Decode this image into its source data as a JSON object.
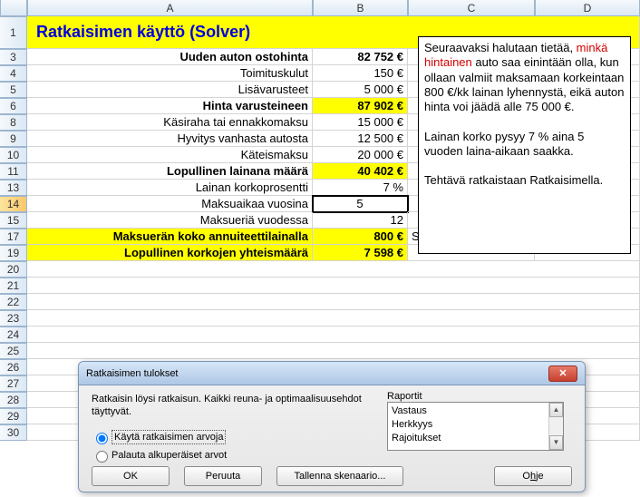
{
  "columns": [
    "A",
    "B",
    "C",
    "D"
  ],
  "row_headers": [
    "1",
    "3",
    "4",
    "5",
    "6",
    "8",
    "9",
    "10",
    "11",
    "13",
    "14",
    "15",
    "17",
    "19",
    "20",
    "21",
    "22",
    "23",
    "24",
    "25",
    "26",
    "27",
    "28",
    "29",
    "30"
  ],
  "selected_row_index": 10,
  "title": "Ratkaisimen käyttö (Solver)",
  "rows": {
    "r3": {
      "a": "Uuden auton ostohinta",
      "b": "82 752 €",
      "bold": true
    },
    "r4": {
      "a": "Toimituskulut",
      "b": "150 €"
    },
    "r5": {
      "a": "Lisävarusteet",
      "b": "5 000 €"
    },
    "r6": {
      "a": "Hinta varusteineen",
      "b": "87 902 €",
      "bold": true,
      "yellow": true
    },
    "r8": {
      "a": "Käsiraha tai ennakkomaksu",
      "b": "15 000 €"
    },
    "r9": {
      "a": "Hyvitys vanhasta autosta",
      "b": "12 500 €"
    },
    "r10": {
      "a": "Käteismaksu",
      "b": "20 000 €"
    },
    "r11": {
      "a": "Lopullinen lainana määrä",
      "b": "40 402 €",
      "bold": true,
      "yellow": true
    },
    "r13": {
      "a": "Lainan korkoprosentti",
      "b": "7 %"
    },
    "r14": {
      "a": "Maksuaikaa vuosina",
      "b": "5",
      "active": true
    },
    "r15": {
      "a": "Maksueriä vuodessa",
      "b": "12"
    },
    "r17": {
      "a": "Maksuerän koko annuiteettilainalla",
      "b": "800 €",
      "bold": true,
      "yellow": true,
      "c": "Solussa käytetty maksu funktiota"
    },
    "r19": {
      "a": "Lopullinen korkojen yhteismäärä",
      "b": "7 598 €",
      "bold": true,
      "yellow": true
    }
  },
  "note": {
    "p1a": "Seuraavaksi halutaan tietää, ",
    "p1red": "minkä hintainen",
    "p1b": " auto saa einintään olla, kun ollaan valmiit maksamaan korkeintaan 800 €/kk lainan lyhennystä, eikä auton hinta voi jäädä alle 75 000 €.",
    "p2": "Lainan korko pysyy 7 % aina 5 vuoden laina-aikaan saakka.",
    "p3": "Tehtävä ratkaistaan Ratkaisimella."
  },
  "dialog": {
    "title": "Ratkaisimen tulokset",
    "msg": "Ratkaisin löysi ratkaisun. Kaikki reuna- ja optimaalisuusehdot täyttyvät.",
    "opt1": "Käytä ratkaisimen arvoja",
    "opt2": "Palauta alkuperäiset arvot",
    "reports_label": "Raportit",
    "reports": [
      "Vastaus",
      "Herkkyys",
      "Rajoitukset"
    ],
    "buttons": {
      "ok": "OK",
      "cancel": "Peruuta",
      "save": "Tallenna skenaario...",
      "help_pre": "O",
      "help_u": "h",
      "help_post": "je"
    }
  },
  "chart_data": {
    "type": "table",
    "title": "Ratkaisimen käyttö (Solver)",
    "rows": [
      {
        "label": "Uuden auton ostohinta",
        "value": 82752,
        "unit": "€"
      },
      {
        "label": "Toimituskulut",
        "value": 150,
        "unit": "€"
      },
      {
        "label": "Lisävarusteet",
        "value": 5000,
        "unit": "€"
      },
      {
        "label": "Hinta varusteineen",
        "value": 87902,
        "unit": "€",
        "computed": true
      },
      {
        "label": "Käsiraha tai ennakkomaksu",
        "value": 15000,
        "unit": "€"
      },
      {
        "label": "Hyvitys vanhasta autosta",
        "value": 12500,
        "unit": "€"
      },
      {
        "label": "Käteismaksu",
        "value": 20000,
        "unit": "€"
      },
      {
        "label": "Lopullinen lainana määrä",
        "value": 40402,
        "unit": "€",
        "computed": true
      },
      {
        "label": "Lainan korkoprosentti",
        "value": 7,
        "unit": "%"
      },
      {
        "label": "Maksuaikaa vuosina",
        "value": 5,
        "unit": "v"
      },
      {
        "label": "Maksueriä vuodessa",
        "value": 12,
        "unit": ""
      },
      {
        "label": "Maksuerän koko annuiteettilainalla",
        "value": 800,
        "unit": "€",
        "computed": true
      },
      {
        "label": "Lopullinen korkojen yhteismäärä",
        "value": 7598,
        "unit": "€",
        "computed": true
      }
    ]
  }
}
